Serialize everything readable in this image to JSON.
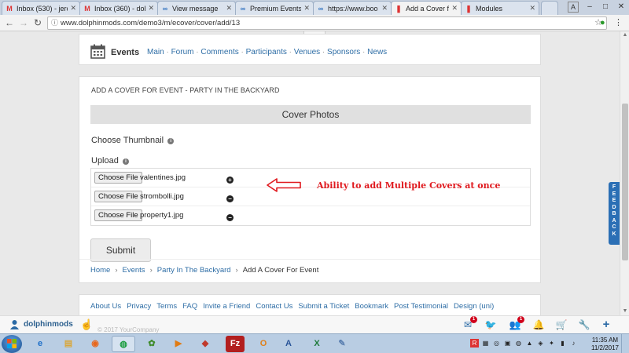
{
  "browser": {
    "tabs": [
      {
        "title": "Inbox (530) - jerc",
        "icon": "gmail-icon",
        "active": false
      },
      {
        "title": "Inbox (360) - dolp",
        "icon": "gmail-icon",
        "active": false
      },
      {
        "title": "View message",
        "icon": "infinity-icon",
        "active": false
      },
      {
        "title": "Premium Events",
        "icon": "infinity-icon",
        "active": false
      },
      {
        "title": "https://www.boo",
        "icon": "infinity-icon",
        "active": false
      },
      {
        "title": "Add a Cover for E",
        "icon": "dolphin-icon",
        "active": true
      },
      {
        "title": "Modules",
        "icon": "dolphin-icon",
        "active": false
      }
    ],
    "user_badge": "A",
    "url": "www.dolphinmods.com/demo3/m/ecover/cover/add/13"
  },
  "events_bar": {
    "title": "Events",
    "menu": [
      "Main",
      "Forum",
      "Comments",
      "Participants",
      "Venues",
      "Sponsors",
      "News"
    ]
  },
  "form": {
    "heading": "ADD A COVER FOR EVENT - PARTY IN THE BACKYARD",
    "section_title": "Cover Photos",
    "thumbnail_label": "Choose Thumbnail",
    "upload_label": "Upload",
    "file_button_label": "Choose File",
    "files": [
      {
        "name": "valentines.jpg",
        "action": "+"
      },
      {
        "name": "strombolli.jpg",
        "action": "−"
      },
      {
        "name": "property1.jpg",
        "action": "−"
      }
    ],
    "submit_label": "Submit"
  },
  "annotation": {
    "text": "Ability to add Multiple Covers at once",
    "color": "#e0191e"
  },
  "breadcrumb": [
    "Home",
    "Events",
    "Party In The Backyard",
    "Add A Cover For Event"
  ],
  "footer_links": [
    "About Us",
    "Privacy",
    "Terms",
    "FAQ",
    "Invite a Friend",
    "Contact Us",
    "Submit a Ticket",
    "Bookmark",
    "Post Testimonial",
    "Design (uni)"
  ],
  "bottom_bar": {
    "brand": "dolphinmods",
    "copyright": "© 2017 YourCompany",
    "mail_badge": "1",
    "friends_badge": "1"
  },
  "feedback_label": "FEEDBACK",
  "taskbar": {
    "time": "11:35 AM",
    "date": "11/2/2017"
  },
  "colors": {
    "link": "#2f6ea6",
    "accent": "#2b6aa5",
    "annotation": "#e0191e"
  }
}
